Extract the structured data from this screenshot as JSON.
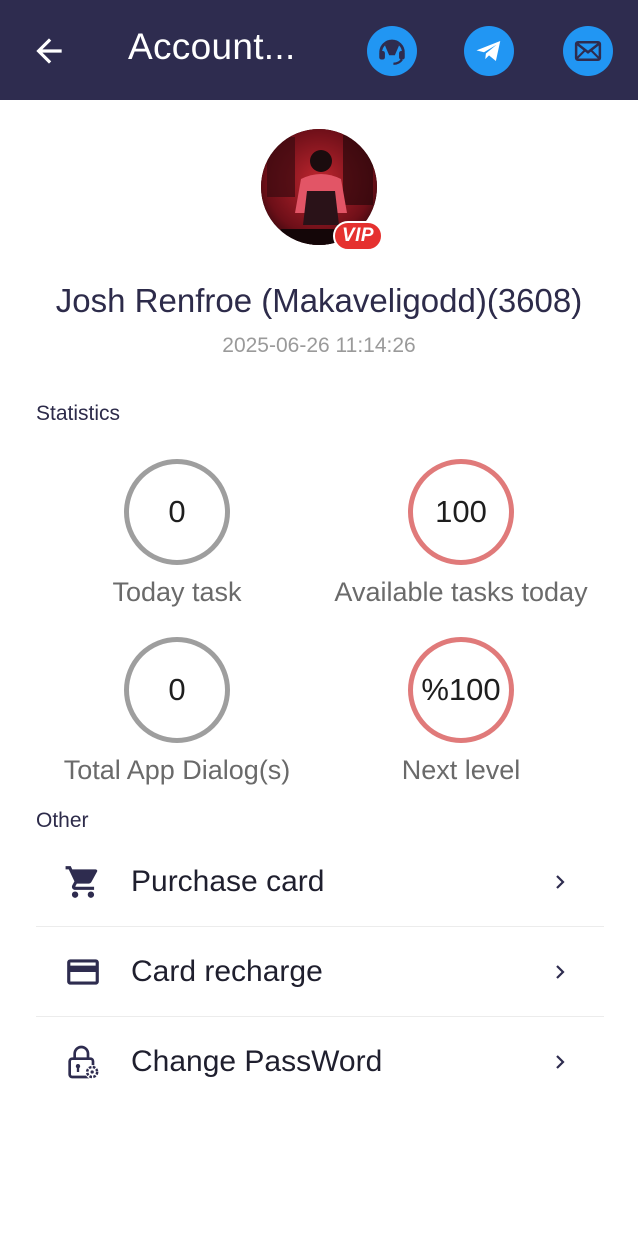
{
  "header": {
    "title": "Account...",
    "back_icon": "back-arrow-icon",
    "actions": [
      {
        "icon": "customer-service-icon"
      },
      {
        "icon": "telegram-icon"
      },
      {
        "icon": "mail-icon"
      }
    ]
  },
  "profile": {
    "vip_badge": "VIP",
    "name": "Josh Renfroe (Makaveligodd)(3608)",
    "datetime": "2025-06-26 11:14:26"
  },
  "statistics": {
    "section_title": "Statistics",
    "items": [
      {
        "value": "0",
        "label": "Today task",
        "ring_color": "#9e9e9e"
      },
      {
        "value": "100",
        "label": "Available tasks today",
        "ring_color": "#e07a7a"
      },
      {
        "value": "0",
        "label": "Total App Dialog(s)",
        "ring_color": "#9e9e9e"
      },
      {
        "value": "%100",
        "label": "Next level",
        "ring_color": "#e07a7a"
      }
    ]
  },
  "other": {
    "section_title": "Other",
    "items": [
      {
        "label": "Purchase card",
        "icon": "cart-icon"
      },
      {
        "label": "Card recharge",
        "icon": "credit-card-icon"
      },
      {
        "label": "Change PassWord",
        "icon": "lock-settings-icon"
      }
    ]
  },
  "colors": {
    "appbar": "#2e2c4f",
    "accent_blue": "#2196f3",
    "vip_red": "#e5312f"
  }
}
